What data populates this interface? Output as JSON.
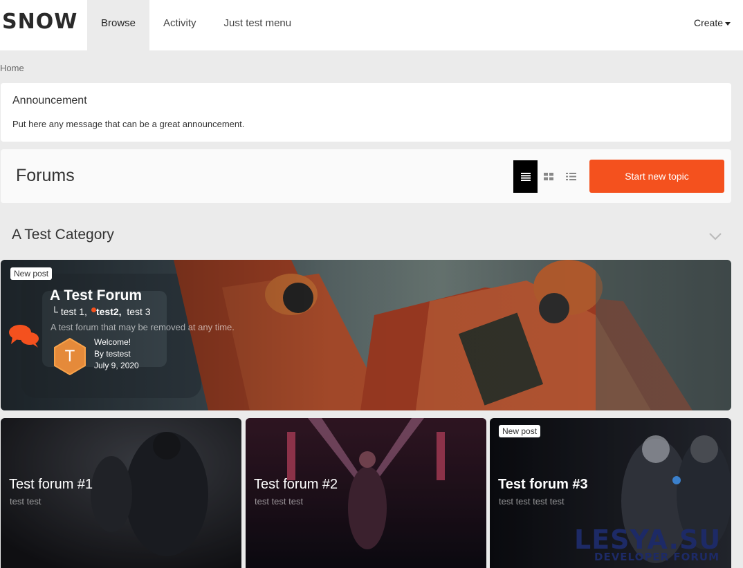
{
  "header": {
    "logo": "SNOW",
    "nav": [
      {
        "label": "Browse",
        "active": true
      },
      {
        "label": "Activity",
        "active": false
      },
      {
        "label": "Just test menu",
        "active": false
      }
    ],
    "create_label": "Create"
  },
  "breadcrumb": "Home",
  "announcement": {
    "title": "Announcement",
    "message": "Put here any message that can be a great announcement."
  },
  "forums_bar": {
    "title": "Forums",
    "view_modes": [
      "list-view-icon",
      "grid-view-icon",
      "compact-view-icon"
    ],
    "start_topic_label": "Start new topic"
  },
  "category": {
    "title": "A Test Category"
  },
  "hero_forum": {
    "badge": "New post",
    "title": "A Test Forum",
    "subforum_prefix": "└ ",
    "subforums": [
      "test 1,",
      "test2,",
      "test 3"
    ],
    "description": "A test forum that may be removed at any time.",
    "avatar_letter": "T",
    "last_post_title": "Welcome!",
    "last_post_by": "By testest",
    "last_post_date": "July 9, 2020"
  },
  "cards": [
    {
      "title": "Test forum #1",
      "description": "test test",
      "badge": ""
    },
    {
      "title": "Test forum #2",
      "description": "test test test",
      "badge": ""
    },
    {
      "title": "Test forum #3",
      "description": "test test test test",
      "badge": "New post"
    }
  ],
  "watermark": {
    "big": "LESYA.SU",
    "small": "DEVELOPER FORUM"
  },
  "colors": {
    "accent": "#f4511e",
    "header_bg": "#ffffff",
    "page_bg": "#ebebeb"
  }
}
